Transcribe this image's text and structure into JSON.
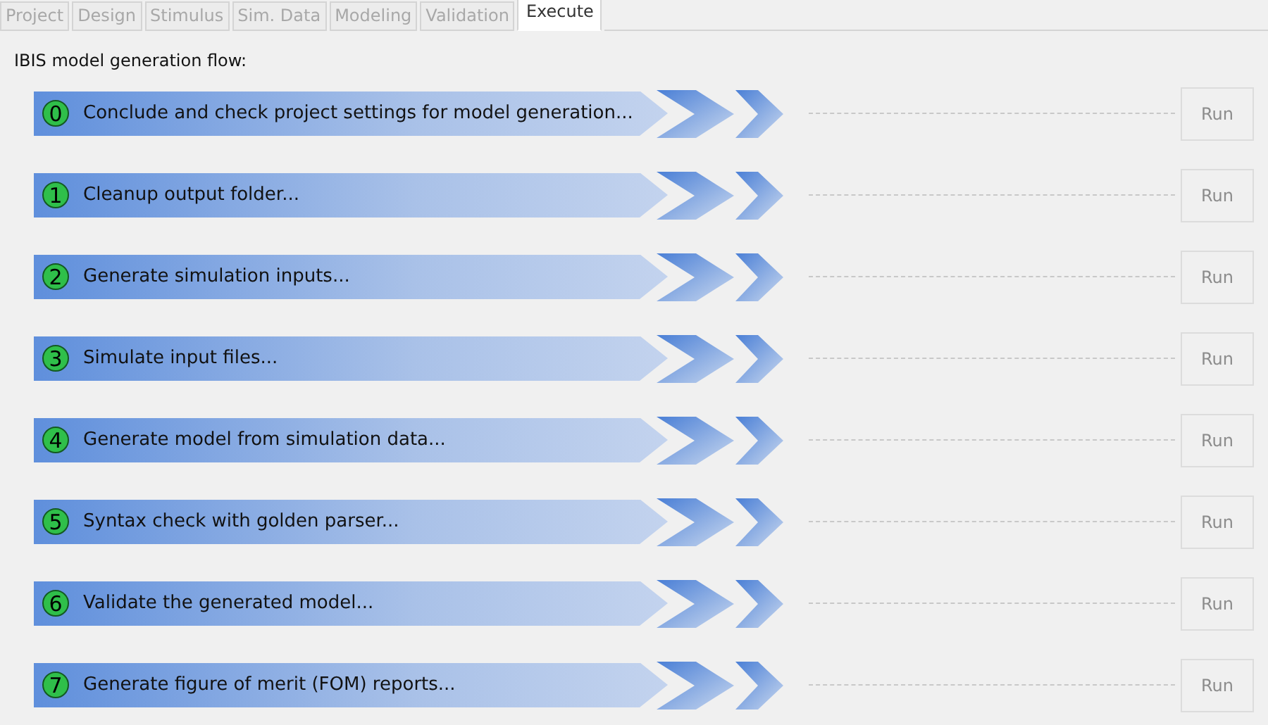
{
  "tabs": [
    {
      "label": "Project",
      "selected": false,
      "disabled": true
    },
    {
      "label": "Design",
      "selected": false,
      "disabled": true
    },
    {
      "label": "Stimulus",
      "selected": false,
      "disabled": true
    },
    {
      "label": "Sim. Data",
      "selected": false,
      "disabled": true
    },
    {
      "label": "Modeling",
      "selected": false,
      "disabled": true
    },
    {
      "label": "Validation",
      "selected": false,
      "disabled": true
    },
    {
      "label": "Execute",
      "selected": true,
      "disabled": false
    }
  ],
  "heading": "IBIS model generation flow:",
  "steps": [
    {
      "number": "0",
      "label": "Conclude and check project settings for model generation...",
      "button": "Run",
      "disabled": true
    },
    {
      "number": "1",
      "label": "Cleanup output folder...",
      "button": "Run",
      "disabled": true
    },
    {
      "number": "2",
      "label": "Generate simulation inputs...",
      "button": "Run",
      "disabled": true
    },
    {
      "number": "3",
      "label": "Simulate input files...",
      "button": "Run",
      "disabled": true
    },
    {
      "number": "4",
      "label": "Generate model from simulation data...",
      "button": "Run",
      "disabled": true
    },
    {
      "number": "5",
      "label": "Syntax check with golden parser...",
      "button": "Run",
      "disabled": true
    },
    {
      "number": "6",
      "label": "Validate the generated model...",
      "button": "Run",
      "disabled": true
    },
    {
      "number": "7",
      "label": "Generate figure of merit (FOM) reports...",
      "button": "Run",
      "disabled": true
    }
  ]
}
